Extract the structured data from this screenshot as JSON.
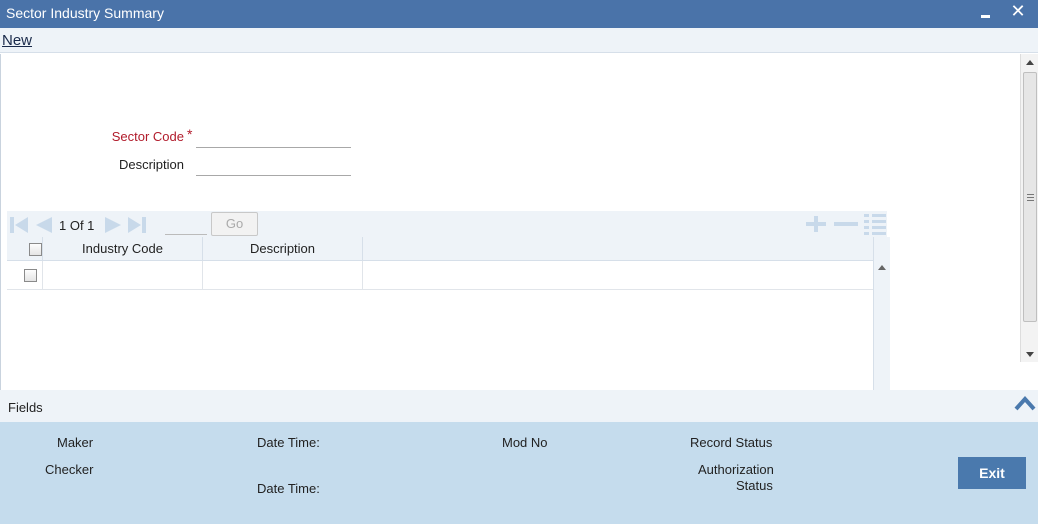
{
  "window": {
    "title": "Sector Industry Summary",
    "minimize_icon": "minimize-icon",
    "close_icon": "close-icon",
    "close_glyph": "✕"
  },
  "menu": {
    "new_label": "New"
  },
  "form": {
    "sector_code_label": "Sector Code",
    "required_mark": "*",
    "sector_code_value": "",
    "description_label": "Description",
    "description_value": ""
  },
  "grid": {
    "pagination": {
      "text": "1 Of 1",
      "page_input": "",
      "go_label": "Go"
    },
    "toolbar_icons": [
      "first-page-icon",
      "prev-page-icon",
      "next-page-icon",
      "last-page-icon",
      "add-row-icon",
      "delete-row-icon",
      "single-record-view-icon"
    ],
    "columns": [
      "Industry Code",
      "Description"
    ],
    "rows": [
      {
        "industry_code": "",
        "description": ""
      }
    ]
  },
  "fields_section": {
    "label": "Fields",
    "collapse_icon": "chevron-up-icon"
  },
  "audit": {
    "maker": "Maker",
    "checker": "Checker",
    "date_time_1": "Date Time:",
    "date_time_2": "Date Time:",
    "mod_no": "Mod No",
    "record_status": "Record Status",
    "authorization_line1": "Authorization",
    "authorization_line2": "Status",
    "exit_label": "Exit"
  },
  "colors": {
    "title_bar": "#4a73a9",
    "required_label": "#b11b2b",
    "footer_bg": "#c5dced",
    "exit_button": "#4a79ad",
    "nav_icons": "#c8d9ea"
  }
}
